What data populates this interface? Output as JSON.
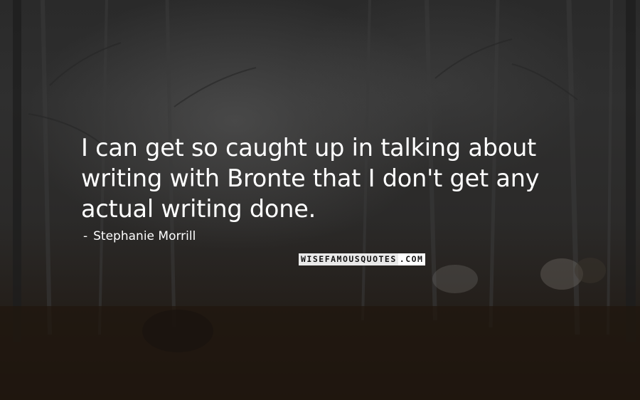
{
  "quote": {
    "text": "I can get so caught up in talking about writing with Bronte that I don't get any actual writing done."
  },
  "author": {
    "dash": "-",
    "name": "Stephanie Morrill"
  },
  "watermark": {
    "part1": "WISEFAMOUSQUOTES",
    "part2": ".COM"
  },
  "colors": {
    "text": "#ffffff",
    "background": "#2b2b2b"
  }
}
